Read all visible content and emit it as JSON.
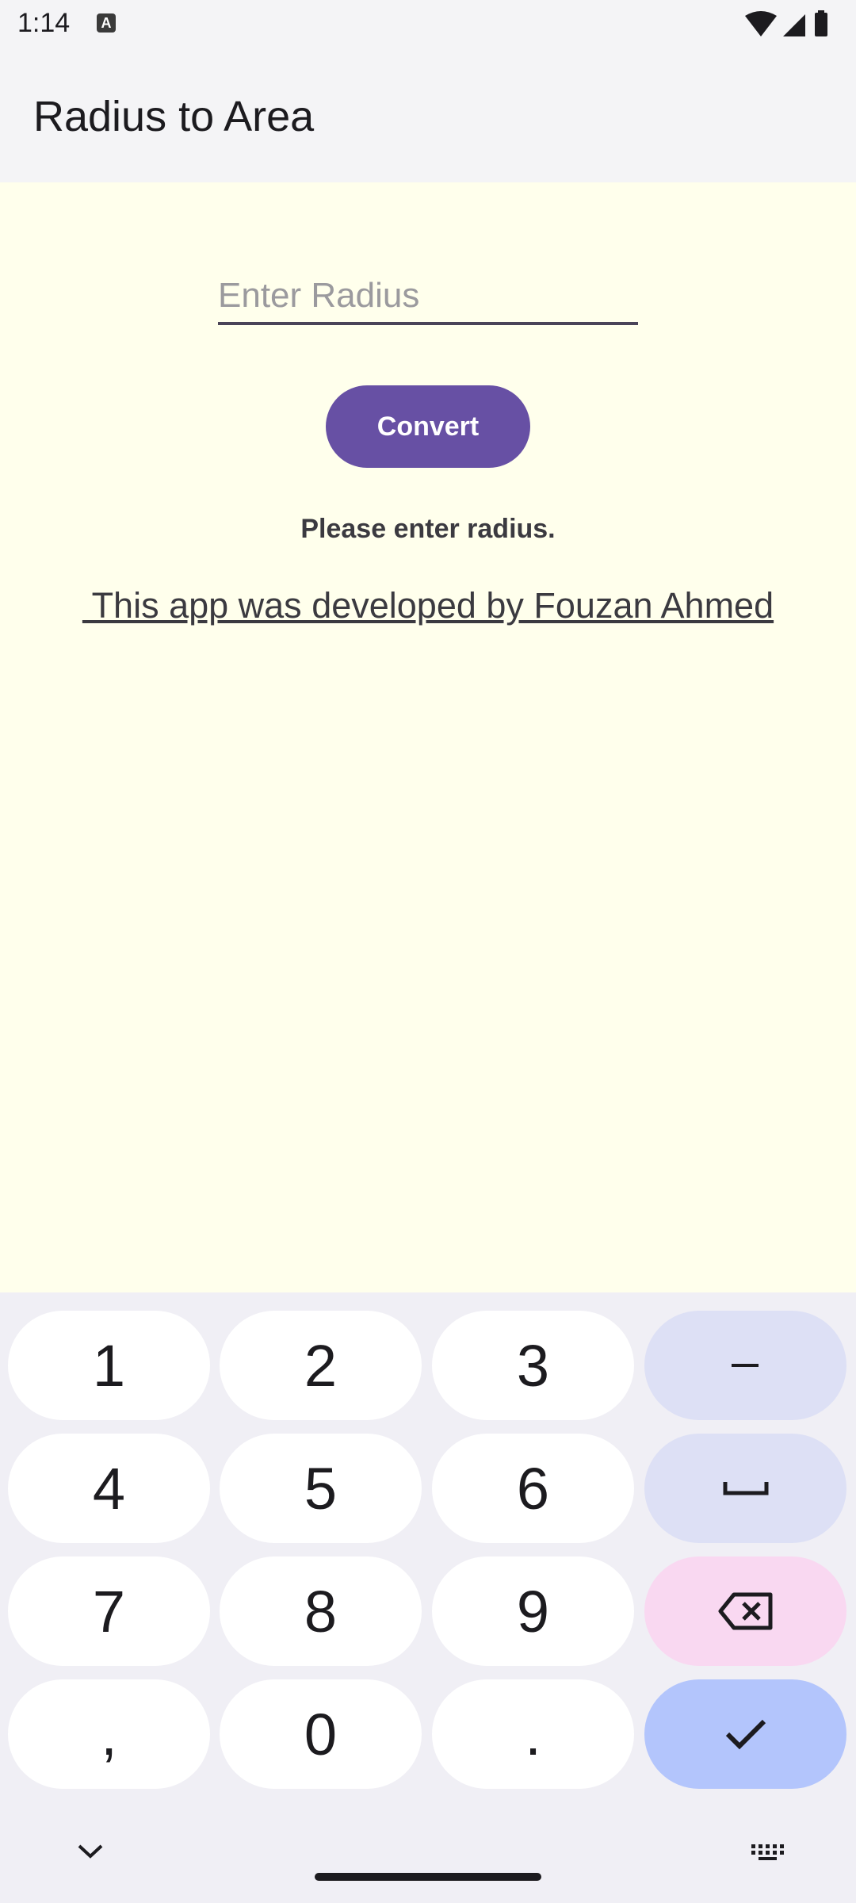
{
  "status": {
    "time": "1:14",
    "notification_letter": "A"
  },
  "app": {
    "title": "Radius to Area"
  },
  "form": {
    "radius_placeholder": "Enter Radius",
    "radius_value": "",
    "convert_label": "Convert",
    "result_text": "Please enter radius.",
    "credit_text": " This app was developed by Fouzan Ahmed"
  },
  "keyboard": {
    "keys": [
      "1",
      "2",
      "3",
      "–",
      "4",
      "5",
      "6",
      "␣",
      "7",
      "8",
      "9",
      "⌫",
      ",",
      "0",
      ".",
      "✓"
    ],
    "func_icons": [
      "minus-icon",
      "space-icon",
      "backspace-icon",
      "check-icon"
    ],
    "colors": {
      "key": "#FFFFFF",
      "func": "#DDE0F5",
      "delete": "#F9D8F1",
      "done": "#B3C5FC"
    }
  },
  "colors": {
    "accent": "#6750A4",
    "content_bg": "#FFFFEC"
  }
}
